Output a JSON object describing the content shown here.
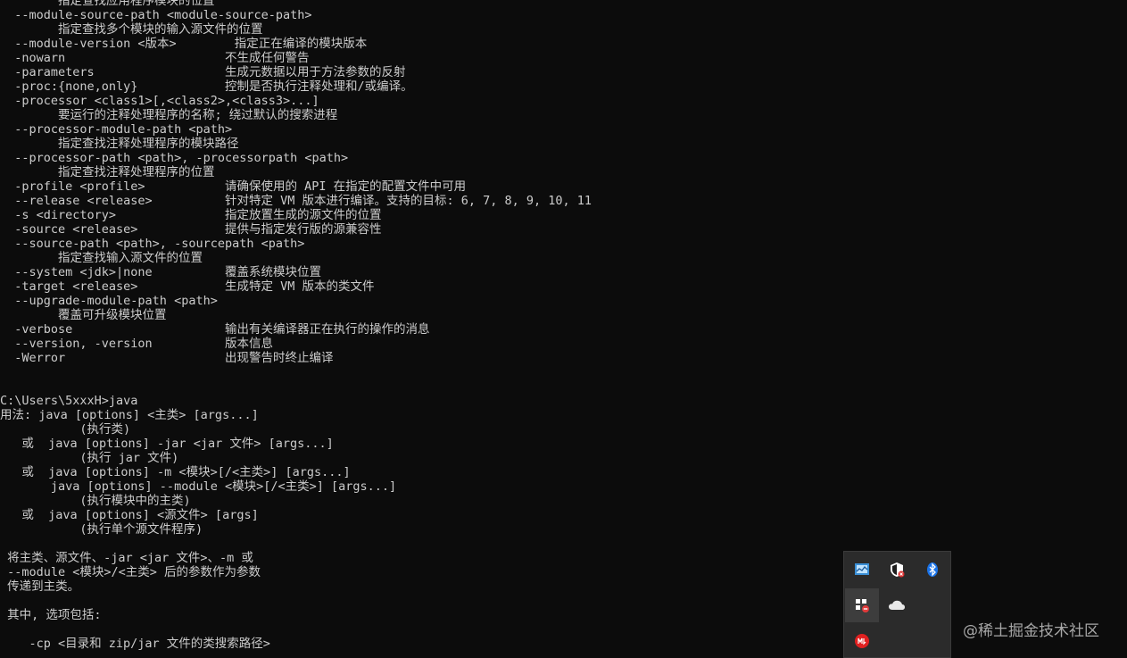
{
  "console": {
    "lines": [
      {
        "t": "        指定查找应用程序模块的位置"
      },
      {
        "t": "  --module-source-path <module-source-path>"
      },
      {
        "t": "        指定查找多个模块的输入源文件的位置"
      },
      {
        "t": "  --module-version <版本>        指定正在编译的模块版本"
      },
      {
        "t": "  -nowarn                      不生成任何警告"
      },
      {
        "t": "  -parameters                  生成元数据以用于方法参数的反射"
      },
      {
        "t": "  -proc:{none,only}            控制是否执行注释处理和/或编译。"
      },
      {
        "t": "  -processor <class1>[,<class2>,<class3>...]"
      },
      {
        "t": "        要运行的注释处理程序的名称; 绕过默认的搜索进程"
      },
      {
        "t": "  --processor-module-path <path>"
      },
      {
        "t": "        指定查找注释处理程序的模块路径"
      },
      {
        "t": "  --processor-path <path>, -processorpath <path>"
      },
      {
        "t": "        指定查找注释处理程序的位置"
      },
      {
        "t": "  -profile <profile>           请确保使用的 API 在指定的配置文件中可用"
      },
      {
        "t": "  --release <release>          针对特定 VM 版本进行编译。支持的目标: 6, 7, 8, 9, 10, 11"
      },
      {
        "t": "  -s <directory>               指定放置生成的源文件的位置"
      },
      {
        "t": "  -source <release>            提供与指定发行版的源兼容性"
      },
      {
        "t": "  --source-path <path>, -sourcepath <path>"
      },
      {
        "t": "        指定查找输入源文件的位置"
      },
      {
        "t": "  --system <jdk>|none          覆盖系统模块位置"
      },
      {
        "t": "  -target <release>            生成特定 VM 版本的类文件"
      },
      {
        "t": "  --upgrade-module-path <path>"
      },
      {
        "t": "        覆盖可升级模块位置"
      },
      {
        "t": "  -verbose                     输出有关编译器正在执行的操作的消息"
      },
      {
        "t": "  --version, -version          版本信息"
      },
      {
        "t": "  -Werror                      出现警告时终止编译"
      },
      {
        "t": ""
      },
      {
        "t": ""
      },
      {
        "t": "C:\\Users\\5xxxH>java"
      },
      {
        "t": "用法: java [options] <主类> [args...]"
      },
      {
        "t": "           (执行类)"
      },
      {
        "t": "   或  java [options] -jar <jar 文件> [args...]"
      },
      {
        "t": "           (执行 jar 文件)"
      },
      {
        "t": "   或  java [options] -m <模块>[/<主类>] [args...]"
      },
      {
        "t": "       java [options] --module <模块>[/<主类>] [args...]"
      },
      {
        "t": "           (执行模块中的主类)"
      },
      {
        "t": "   或  java [options] <源文件> [args]"
      },
      {
        "t": "           (执行单个源文件程序)"
      },
      {
        "t": ""
      },
      {
        "t": " 将主类、源文件、-jar <jar 文件>、-m 或"
      },
      {
        "t": " --module <模块>/<主类> 后的参数作为参数"
      },
      {
        "t": " 传递到主类。"
      },
      {
        "t": ""
      },
      {
        "t": " 其中, 选项包括:"
      },
      {
        "t": ""
      },
      {
        "t": "    -cp <目录和 zip/jar 文件的类搜索路径>"
      }
    ]
  },
  "tray": {
    "icons": [
      {
        "name": "network-monitor-icon"
      },
      {
        "name": "security-shield-icon"
      },
      {
        "name": "bluetooth-icon"
      },
      {
        "name": "app-blocked-icon"
      },
      {
        "name": "onedrive-cloud-icon"
      },
      {
        "name": "red-app-icon"
      }
    ]
  },
  "watermark": {
    "text": "@稀土掘金技术社区"
  },
  "colors": {
    "background": "#0c0c0c",
    "text": "#cccccc",
    "tray": "#2b2b2b"
  }
}
